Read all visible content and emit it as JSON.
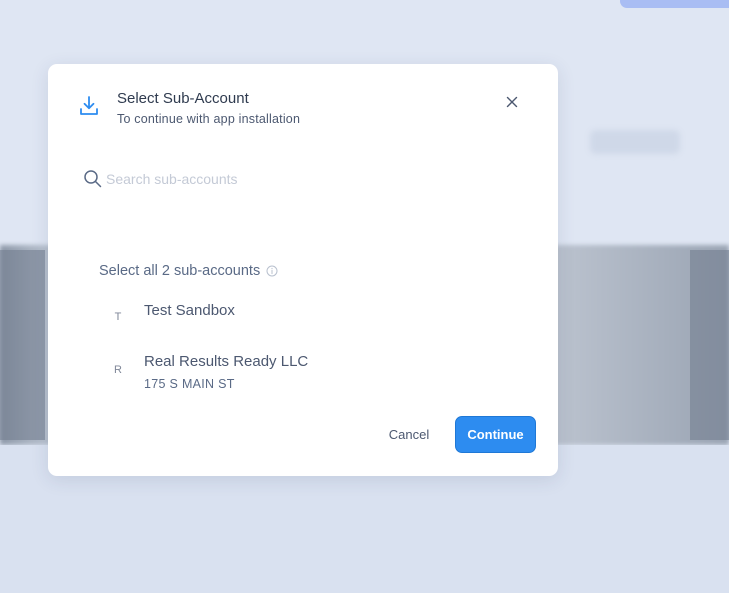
{
  "modal": {
    "title": "Select Sub-Account",
    "subtitle": "To continue with app installation",
    "header_icon": "download-icon",
    "close_icon": "close-icon"
  },
  "search": {
    "placeholder": "Search sub-accounts",
    "value": "",
    "icon": "search-icon"
  },
  "select_all": {
    "label": "Select all 2 sub-accounts",
    "icon": "info-icon"
  },
  "accounts": [
    {
      "initial": "T",
      "name": "Test Sandbox",
      "address": ""
    },
    {
      "initial": "R",
      "name": "Real Results Ready LLC",
      "address": "175 S MAIN ST"
    }
  ],
  "actions": {
    "cancel_label": "Cancel",
    "continue_label": "Continue"
  },
  "colors": {
    "accent": "#2d8cf0",
    "backdrop": "#dfe6f3",
    "text_primary": "#2f3b4f",
    "text_secondary": "#5a6a86"
  }
}
